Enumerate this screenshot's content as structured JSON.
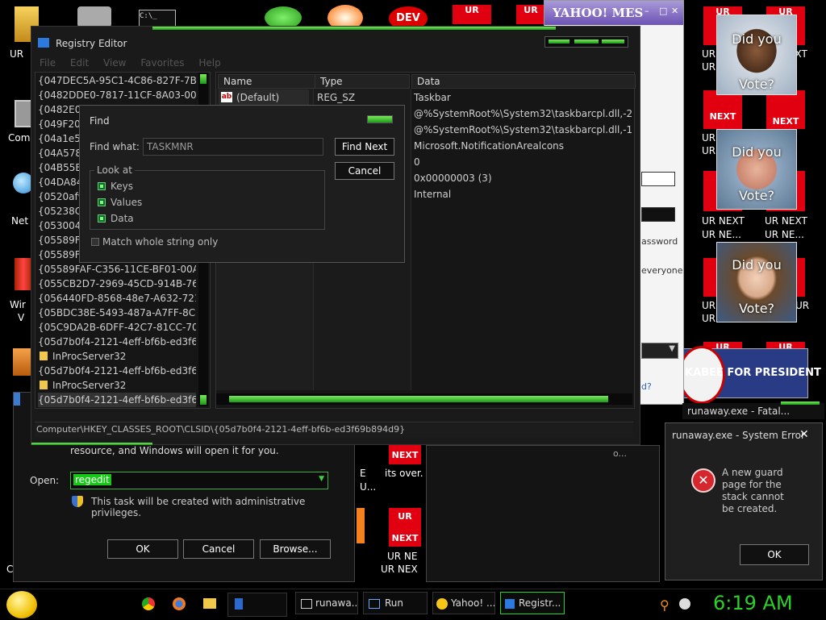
{
  "desktop": {
    "icons_left": [
      "UR",
      "Com",
      "Net",
      "Wir",
      "V"
    ],
    "tiles": {
      "ur": "UR",
      "next": "NEXT",
      "ur_next": "UR NEXT",
      "ur_ne": "UR NE...",
      "ur_nex": "UR NEX",
      "ur_next2": "UR NE",
      "its_over": "its over.",
      "e": "E",
      "u": "U...",
      "ur_n": "UR",
      "ur2": "UR"
    },
    "portraits": [
      {
        "top": "Did you",
        "bottom": "Vote?"
      },
      {
        "top": "Did you",
        "bottom": "Vote?"
      },
      {
        "top": "Did you",
        "bottom": "Vote?"
      }
    ],
    "banner": "KABEE FOR PRESIDENT",
    "dev_icon": "DEV"
  },
  "yahoo": {
    "title": "YAHOO! MES",
    "frag_password": "assword",
    "frag_everyone": "everyone",
    "frag_d": "d?",
    "win_controls": [
      "–",
      "□",
      "✕"
    ]
  },
  "regedit": {
    "title": "Registry Editor",
    "menu": [
      "File",
      "Edit",
      "View",
      "Favorites",
      "Help"
    ],
    "tree": [
      "{047DEC5A-95C1-4C86-827F-7B8",
      "{0482DDE0-7817-11CF-8A03-00A",
      "{0482E0",
      "{049F20",
      "{04a1e5",
      "{04A578",
      "{04B55E",
      "{04DA84",
      "{0520af9",
      "{05238C",
      "{053004",
      "{05589F",
      "{05589F",
      "{05589FAF-C356-11CE-BF01-00A",
      "{055CB2D7-2969-45CD-914B-7689",
      "{056440FD-8568-48e7-A632-7215",
      "{05BDC38E-5493-487a-A7FF-8CF",
      "{05C9DA2B-6DFF-42C7-81CC-70",
      "{05d7b0f4-2121-4eff-bf6b-ed3f69b8",
      "InProcServer32",
      "{05d7b0f4-2121-4eff-bf6b-ed3f69b8",
      "InProcServer32",
      "{05d7b0f4-2121-4eff-bf6b-ed3f69b8"
    ],
    "columns": {
      "name": "Name",
      "type": "Type",
      "data": "Data"
    },
    "rows": [
      {
        "name": "(Default)",
        "type": "REG_SZ",
        "data": "Taskbar"
      },
      {
        "name": "",
        "type": "",
        "data": "@%SystemRoot%\\System32\\taskbarcpl.dll,-2"
      },
      {
        "name": "",
        "type": "",
        "data": "@%SystemRoot%\\System32\\taskbarcpl.dll,-1"
      },
      {
        "name": "",
        "type": "",
        "data": "Microsoft.NotificationArealcons"
      },
      {
        "name": "",
        "type": "",
        "data": "0"
      },
      {
        "name": "",
        "type": "",
        "data": "0x00000003 (3)"
      },
      {
        "name": "",
        "type": "",
        "data": "Internal"
      }
    ],
    "status": "Computer\\HKEY_CLASSES_ROOT\\CLSID\\{05d7b0f4-2121-4eff-bf6b-ed3f69b894d9}"
  },
  "find": {
    "title": "Find",
    "find_what_label": "Find what:",
    "find_what_value": "TASKMNR",
    "find_next": "Find Next",
    "cancel": "Cancel",
    "look_at": "Look at",
    "keys": "Keys",
    "values": "Values",
    "data": "Data",
    "match_whole": "Match whole string only"
  },
  "run": {
    "desc": "resource, and Windows will open it for you.",
    "open_label": "Open:",
    "open_value": "regedit",
    "admin_note": "This task will be created with administrative privileges.",
    "ok": "OK",
    "cancel": "Cancel",
    "browse": "Browse..."
  },
  "error": {
    "fatal_title": "runaway.exe - Fatal...",
    "title": "runaway.exe - System Error",
    "message": "A new guard page for the stack cannot be created.",
    "ok": "OK"
  },
  "other": {
    "frag_c": "C",
    "frag_onet": "o..."
  },
  "taskbar": {
    "items": [
      "runawa...",
      "Run",
      "Yahoo! ...",
      "Registr..."
    ],
    "clock": "6:19 AM"
  },
  "colors": {
    "accent": "#2bd12b",
    "error": "#d6262e",
    "tile_red": "#e00010"
  }
}
